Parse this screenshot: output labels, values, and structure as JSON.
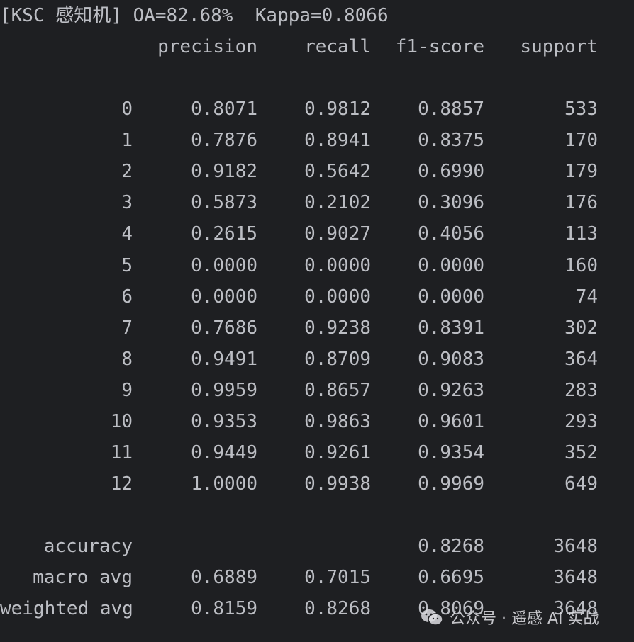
{
  "header": "[KSC 感知机] OA=82.68%  Kappa=0.8066",
  "columns": [
    "",
    "precision",
    "recall",
    "f1-score",
    "support"
  ],
  "rows": [
    {
      "label": "0",
      "precision": "0.8071",
      "recall": "0.9812",
      "f1": "0.8857",
      "support": "533"
    },
    {
      "label": "1",
      "precision": "0.7876",
      "recall": "0.8941",
      "f1": "0.8375",
      "support": "170"
    },
    {
      "label": "2",
      "precision": "0.9182",
      "recall": "0.5642",
      "f1": "0.6990",
      "support": "179"
    },
    {
      "label": "3",
      "precision": "0.5873",
      "recall": "0.2102",
      "f1": "0.3096",
      "support": "176"
    },
    {
      "label": "4",
      "precision": "0.2615",
      "recall": "0.9027",
      "f1": "0.4056",
      "support": "113"
    },
    {
      "label": "5",
      "precision": "0.0000",
      "recall": "0.0000",
      "f1": "0.0000",
      "support": "160"
    },
    {
      "label": "6",
      "precision": "0.0000",
      "recall": "0.0000",
      "f1": "0.0000",
      "support": "74"
    },
    {
      "label": "7",
      "precision": "0.7686",
      "recall": "0.9238",
      "f1": "0.8391",
      "support": "302"
    },
    {
      "label": "8",
      "precision": "0.9491",
      "recall": "0.8709",
      "f1": "0.9083",
      "support": "364"
    },
    {
      "label": "9",
      "precision": "0.9959",
      "recall": "0.8657",
      "f1": "0.9263",
      "support": "283"
    },
    {
      "label": "10",
      "precision": "0.9353",
      "recall": "0.9863",
      "f1": "0.9601",
      "support": "293"
    },
    {
      "label": "11",
      "precision": "0.9449",
      "recall": "0.9261",
      "f1": "0.9354",
      "support": "352"
    },
    {
      "label": "12",
      "precision": "1.0000",
      "recall": "0.9938",
      "f1": "0.9969",
      "support": "649"
    }
  ],
  "summary": [
    {
      "label": "accuracy",
      "precision": "",
      "recall": "",
      "f1": "0.8268",
      "support": "3648"
    },
    {
      "label": "macro avg",
      "precision": "0.6889",
      "recall": "0.7015",
      "f1": "0.6695",
      "support": "3648"
    },
    {
      "label": "weighted avg",
      "precision": "0.8159",
      "recall": "0.8268",
      "f1": "0.8069",
      "support": "3648"
    }
  ],
  "watermark": {
    "text": "公众号 · 遥感 AI 实战",
    "icon": "wechat-icon"
  },
  "colors": {
    "background": "#1e1f22",
    "text": "#bcbec4"
  }
}
